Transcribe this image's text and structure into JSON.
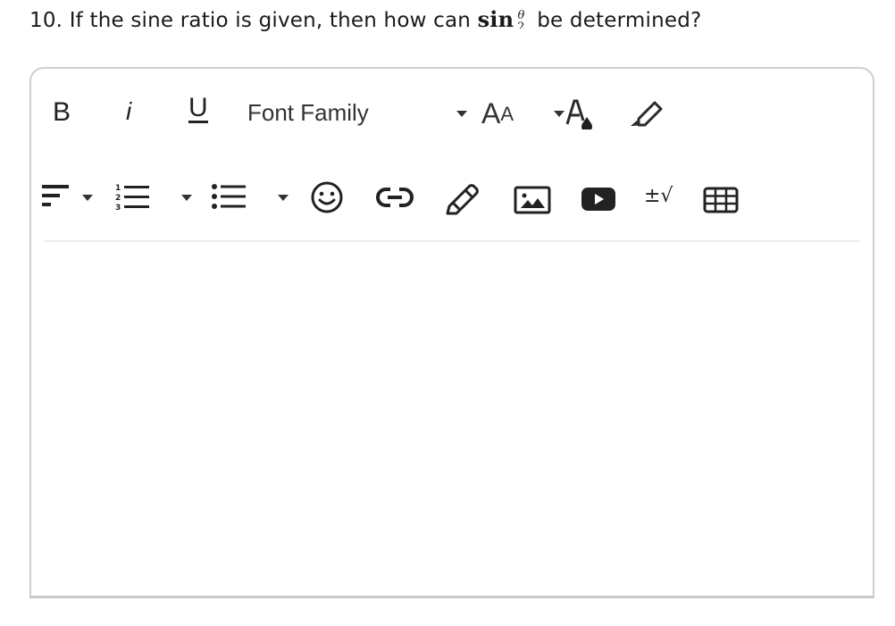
{
  "question": {
    "prefix": "10. If the sine ratio is given, then how can ",
    "math_fn": "sin",
    "fraction_numerator": "θ",
    "fraction_denominator": "2",
    "suffix": " be determined?"
  },
  "editor": {
    "toolbar_row1": {
      "bold_label": "B",
      "italic_label": "i",
      "underline_label": "U",
      "font_family_label": "Font Family",
      "font_size_big": "A",
      "font_size_small": "A"
    },
    "toolbar_row2": {
      "math_label": "±√"
    },
    "content": ""
  }
}
